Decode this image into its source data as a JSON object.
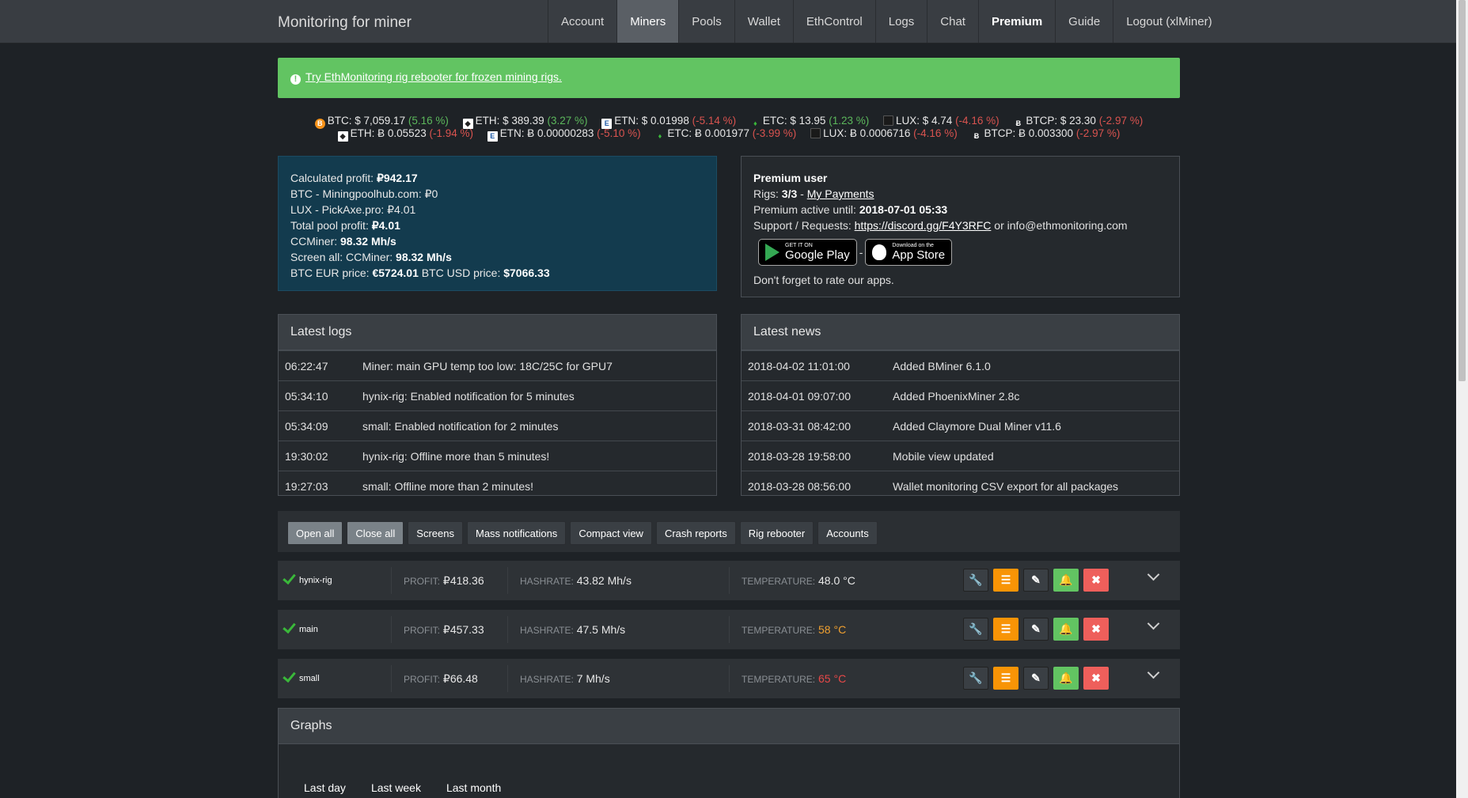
{
  "brand": "Monitoring for miner",
  "nav": [
    "Account",
    "Miners",
    "Pools",
    "Wallet",
    "EthControl",
    "Logs",
    "Chat",
    "Premium",
    "Guide",
    "Logout (xlMiner)"
  ],
  "alert": {
    "link": "Try EthMonitoring rig rebooter for frozen mining rigs."
  },
  "ticker_row1": [
    {
      "coin": "BTC",
      "text": "BTC: $ 7,059.17",
      "change": "(5.16 %)",
      "dir": "pos"
    },
    {
      "coin": "ETH",
      "text": "ETH: $ 389.39",
      "change": "(3.27 %)",
      "dir": "pos"
    },
    {
      "coin": "ETN",
      "text": "ETN: $ 0.01998",
      "change": "(-5.14 %)",
      "dir": "neg"
    },
    {
      "coin": "ETC",
      "text": "ETC: $ 13.95",
      "change": "(1.23 %)",
      "dir": "pos"
    },
    {
      "coin": "LUX",
      "text": "LUX: $ 4.74",
      "change": "(-4.16 %)",
      "dir": "neg"
    },
    {
      "coin": "BTCP",
      "text": "BTCP: $ 23.30",
      "change": "(-2.97 %)",
      "dir": "neg"
    }
  ],
  "ticker_row2": [
    {
      "coin": "ETH",
      "text": "ETH: Ƀ 0.05523",
      "change": "(-1.94 %)",
      "dir": "neg"
    },
    {
      "coin": "ETN",
      "text": "ETN: Ƀ 0.00000283",
      "change": "(-5.10 %)",
      "dir": "neg"
    },
    {
      "coin": "ETC",
      "text": "ETC: Ƀ 0.001977",
      "change": "(-3.99 %)",
      "dir": "neg"
    },
    {
      "coin": "LUX",
      "text": "LUX: Ƀ 0.0006716",
      "change": "(-4.16 %)",
      "dir": "neg"
    },
    {
      "coin": "BTCP",
      "text": "BTCP: Ƀ 0.003300",
      "change": "(-2.97 %)",
      "dir": "neg"
    }
  ],
  "profit": {
    "calc_label": "Calculated profit:",
    "calc_value": "₽942.17",
    "btc_pool": "BTC - Miningpoolhub.com: ₽0",
    "lux_pool": "LUX - PickAxe.pro: ₽4.01",
    "total_label": "Total pool profit:",
    "total_value": "₽4.01",
    "ccminer_label": "CCMiner:",
    "ccminer_value": "98.32 Mh/s",
    "screen_label": "Screen all: CCMiner:",
    "screen_value": "98.32 Mh/s",
    "eur_label": "BTC EUR price:",
    "eur_value": "€5724.01",
    "usd_label": "BTC USD price:",
    "usd_value": "$7066.33"
  },
  "premium": {
    "title": "Premium user",
    "rigs_label": "Rigs:",
    "rigs_value": "3/3",
    "rigs_sep": "-",
    "payments_link": "My Payments",
    "active_label": "Premium active until:",
    "active_value": "2018-07-01 05:33",
    "support_label": "Support / Requests:",
    "discord_link": "https://discord.gg/F4Y3RFC",
    "support_or": "or info@ethmonitoring.com",
    "google_small": "GET IT ON",
    "google_big": "Google Play",
    "apple_small": "Download on the",
    "apple_big": "App Store",
    "badge_sep": "-",
    "rate": "Don't forget to rate our apps."
  },
  "logs": {
    "title": "Latest logs",
    "rows": [
      {
        "time": "06:22:47",
        "msg": "Miner: main GPU temp too low: 18C/25C for GPU7"
      },
      {
        "time": "05:34:10",
        "msg": "hynix-rig: Enabled notification for 5 minutes"
      },
      {
        "time": "05:34:09",
        "msg": "small: Enabled notification for 2 minutes"
      },
      {
        "time": "19:30:02",
        "msg": "hynix-rig: Offline more than 5 minutes!"
      },
      {
        "time": "19:27:03",
        "msg": "small: Offline more than 2 minutes!"
      }
    ]
  },
  "news": {
    "title": "Latest news",
    "rows": [
      {
        "date": "2018-04-02 11:01:00",
        "msg": "Added BMiner 6.1.0"
      },
      {
        "date": "2018-04-01 09:07:00",
        "msg": "Added PhoenixMiner 2.8c"
      },
      {
        "date": "2018-03-31 08:42:00",
        "msg": "Added Claymore Dual Miner v11.6"
      },
      {
        "date": "2018-03-28 19:58:00",
        "msg": "Mobile view updated"
      },
      {
        "date": "2018-03-28 08:56:00",
        "msg": "Wallet monitoring CSV export for all packages"
      }
    ]
  },
  "buttons": [
    "Open all",
    "Close all",
    "Screens",
    "Mass notifications",
    "Compact view",
    "Crash reports",
    "Rig rebooter",
    "Accounts"
  ],
  "rigs": [
    {
      "name": "hynix-rig",
      "profit_label": "PROFIT:",
      "profit": "₽418.36",
      "hash_label": "HASHRATE:",
      "hash": "43.82 Mh/s",
      "temp_label": "TEMPERATURE:",
      "temp": "48.0 °C",
      "temp_state": "ok"
    },
    {
      "name": "main",
      "profit_label": "PROFIT:",
      "profit": "₽457.33",
      "hash_label": "HASHRATE:",
      "hash": "47.5 Mh/s",
      "temp_label": "TEMPERATURE:",
      "temp": "58 °C",
      "temp_state": "warn"
    },
    {
      "name": "small",
      "profit_label": "PROFIT:",
      "profit": "₽66.48",
      "hash_label": "HASHRATE:",
      "hash": "7 Mh/s",
      "temp_label": "TEMPERATURE:",
      "temp": "65 °C",
      "temp_state": "hot"
    }
  ],
  "graphs": {
    "title": "Graphs",
    "tabs": [
      "Last day",
      "Last week",
      "Last month"
    ]
  },
  "colors": {
    "alert_green": "#62c462",
    "profit_panel": "#133b4e",
    "warn": "#f0a030",
    "hot": "#e84848",
    "up": "#5cb85c",
    "down": "#d9534f"
  }
}
